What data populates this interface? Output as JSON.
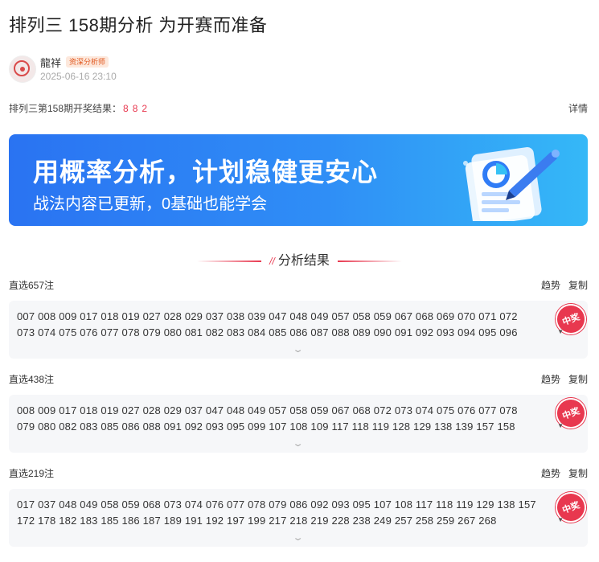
{
  "title": "排列三 158期分析 为开赛而准备",
  "author": {
    "name": "龍祥",
    "badge": "资深分析师",
    "time": "2025-06-16 23:10"
  },
  "result": {
    "label": "排列三第158期开奖结果：",
    "numbers": [
      "8",
      "8",
      "2"
    ],
    "detail": "详情"
  },
  "banner": {
    "title": "用概率分析，计划稳健更安心",
    "subtitle": "战法内容已更新，0基础也能学会"
  },
  "section_title": "分析结果",
  "actions": {
    "trend": "趋势",
    "copy": "复制"
  },
  "stamp": "中奖",
  "groups": [
    {
      "label": "直选657注",
      "numbers": "007 008 009 017 018 019 027 028 029 037 038 039 047 048 049 057 058 059 067 068 069 070 071 072 073 074 075 076 077 078 079 080 081 082 083 084 085 086 087 088 089 090 091 092 093 094 095 096"
    },
    {
      "label": "直选438注",
      "numbers": "008 009 017 018 019 027 028 029 037 047 048 049 057 058 059 067 068 072 073 074 075 076 077 078 079 080 082 083 085 086 088 091 092 093 095 099 107 108 109 117 118 119 128 129 138 139 157 158"
    },
    {
      "label": "直选219注",
      "numbers": "017 037 048 049 058 059 068 073 074 076 077 078 079 086 092 093 095 107 108 117 118 119 129 138 157 172 178 182 183 185 186 187 189 191 192 197 199 217 218 219 228 238 249 257 258 259 267 268"
    }
  ]
}
